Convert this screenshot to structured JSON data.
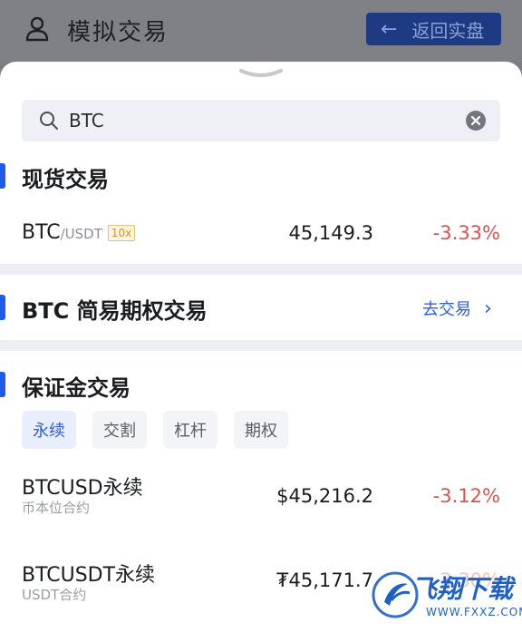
{
  "header": {
    "title": "模拟交易",
    "back_label": "返回实盘"
  },
  "search": {
    "value": "BTC"
  },
  "spot": {
    "title": "现货交易",
    "rows": [
      {
        "base": "BTC",
        "quote": "/USDT",
        "leverage": "10x",
        "price": "45,149.3",
        "change": "-3.33%"
      }
    ]
  },
  "options": {
    "title": "BTC 简易期权交易",
    "action_label": "去交易"
  },
  "margin": {
    "title": "保证金交易",
    "tabs": [
      "永续",
      "交割",
      "杠杆",
      "期权"
    ],
    "active_tab": 0,
    "rows": [
      {
        "name": "BTCUSD永续",
        "sub": "币本位合约",
        "price": "$45,216.2",
        "change": "-3.12%"
      },
      {
        "name": "BTCUSDT永续",
        "sub": "USDT合约",
        "price": "₮45,171.7",
        "change": "-3.30%"
      }
    ]
  },
  "watermark": {
    "text": "飞翔下载",
    "sub": "WWW.FXXZ.COM"
  },
  "colors": {
    "accent": "#1e5be6",
    "negative": "#d9534f",
    "back_button": "#1d3a82"
  }
}
